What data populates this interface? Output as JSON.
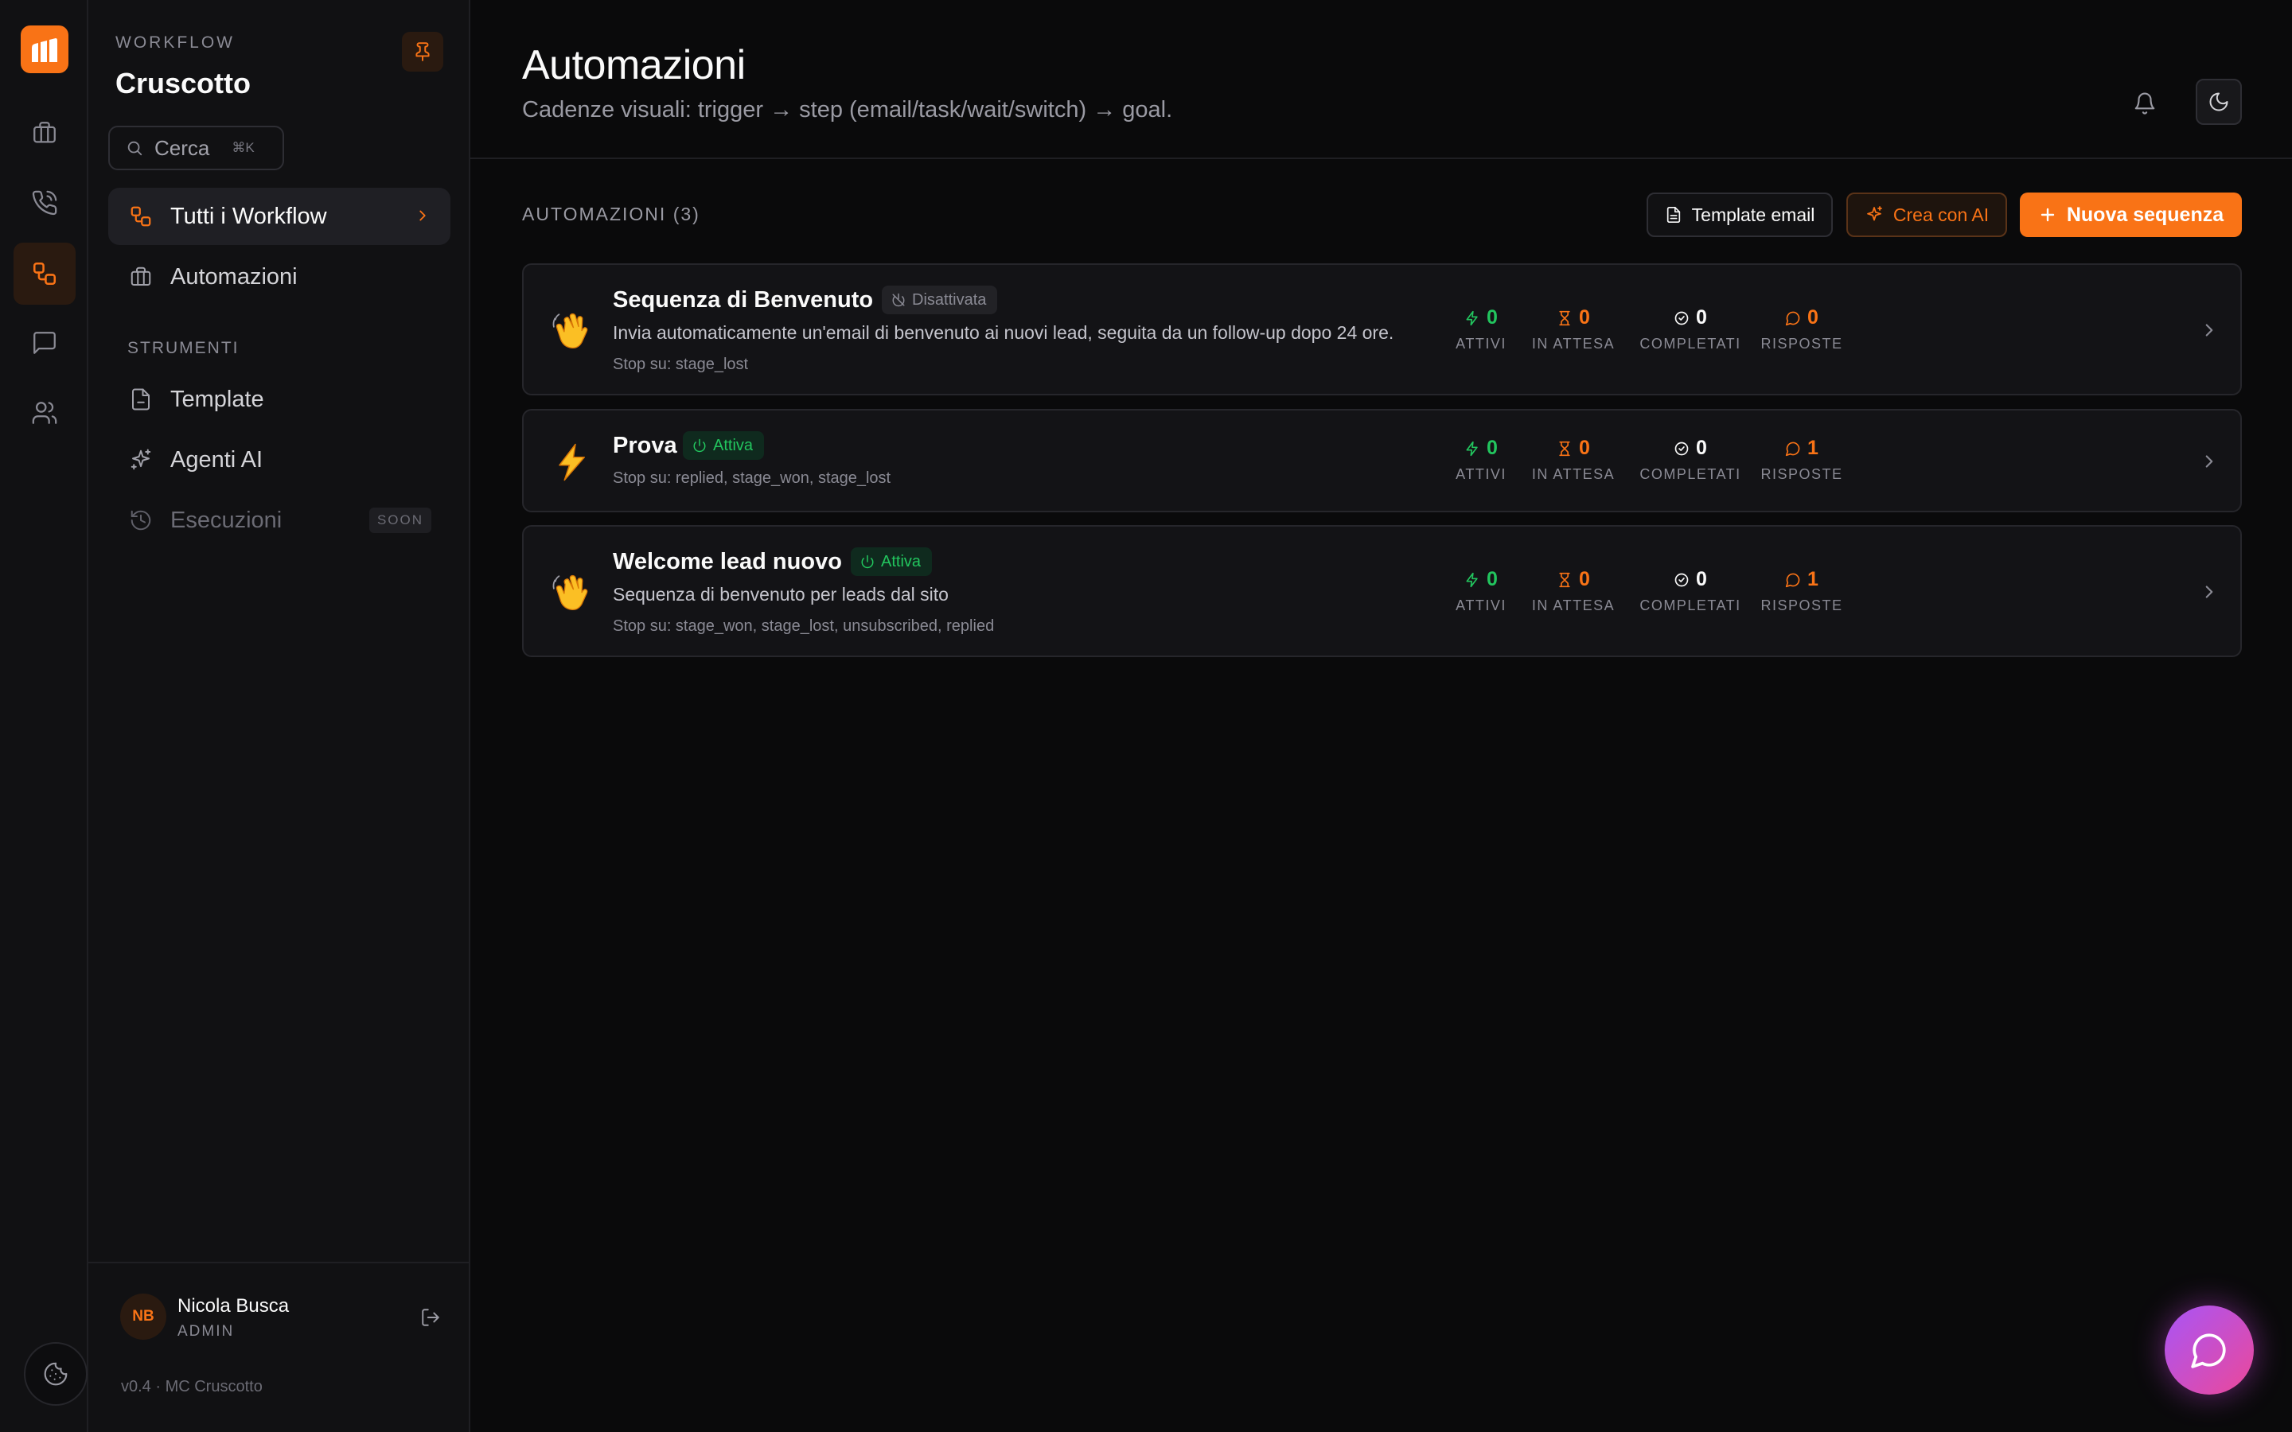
{
  "rail": {
    "items": [
      {
        "icon": "briefcase-icon"
      },
      {
        "icon": "phone-call-icon"
      },
      {
        "icon": "workflow-icon",
        "active": true
      },
      {
        "icon": "message-square-icon"
      },
      {
        "icon": "users-icon"
      }
    ],
    "bottom_icon": "cookie-icon"
  },
  "sidebar": {
    "eyebrow": "WORKFLOW",
    "title": "Cruscotto",
    "search": {
      "placeholder": "Cerca",
      "shortcut": "⌘K"
    },
    "items": [
      {
        "label": "Tutti i Workflow",
        "icon": "workflow-icon",
        "active": true
      },
      {
        "label": "Automazioni",
        "icon": "briefcase-icon"
      }
    ],
    "section_title": "STRUMENTI",
    "tools": [
      {
        "label": "Template",
        "icon": "file-icon"
      },
      {
        "label": "Agenti AI",
        "icon": "sparkles-icon"
      },
      {
        "label": "Esecuzioni",
        "icon": "history-icon",
        "disabled": true,
        "badge": "SOON"
      }
    ],
    "user": {
      "initials": "NB",
      "name": "Nicola Busca",
      "role": "ADMIN"
    },
    "version": "v0.4 · MC Cruscotto"
  },
  "header": {
    "title": "Automazioni",
    "subtitle": "Cadenze visuali: trigger → step (email/task/wait/switch) → goal."
  },
  "toolbar": {
    "list_label": "AUTOMAZIONI (3)",
    "template_label": "Template email",
    "ai_label": "Crea con AI",
    "new_label": "Nuova sequenza"
  },
  "stat_labels": {
    "active": "ATTIVI",
    "waiting": "IN ATTESA",
    "completed": "COMPLETATI",
    "replies": "RISPOSTE"
  },
  "automations": [
    {
      "emoji": "waving-hand",
      "title": "Sequenza di Benvenuto",
      "status": "Disattivata",
      "description": "Invia automaticamente un'email di benvenuto ai nuovi lead, seguita da un follow-up dopo 24 ore.",
      "stop": "Stop su: stage_lost",
      "stats": {
        "active": "0",
        "waiting": "0",
        "completed": "0",
        "replies": "0"
      }
    },
    {
      "emoji": "high-voltage",
      "title": "Prova",
      "status": "Attiva",
      "description": "",
      "stop": "Stop su: replied, stage_won, stage_lost",
      "stats": {
        "active": "0",
        "waiting": "0",
        "completed": "0",
        "replies": "1"
      }
    },
    {
      "emoji": "waving-hand",
      "title": "Welcome lead nuovo",
      "status": "Attiva",
      "description": "Sequenza di benvenuto per leads dal sito",
      "stop": "Stop su: stage_won, stage_lost, unsubscribed, replied",
      "stats": {
        "active": "0",
        "waiting": "0",
        "completed": "0",
        "replies": "1"
      }
    }
  ],
  "colors": {
    "accent": "#f97316",
    "success": "#22c55e",
    "background": "#0a0a0b",
    "surface": "#131316"
  }
}
